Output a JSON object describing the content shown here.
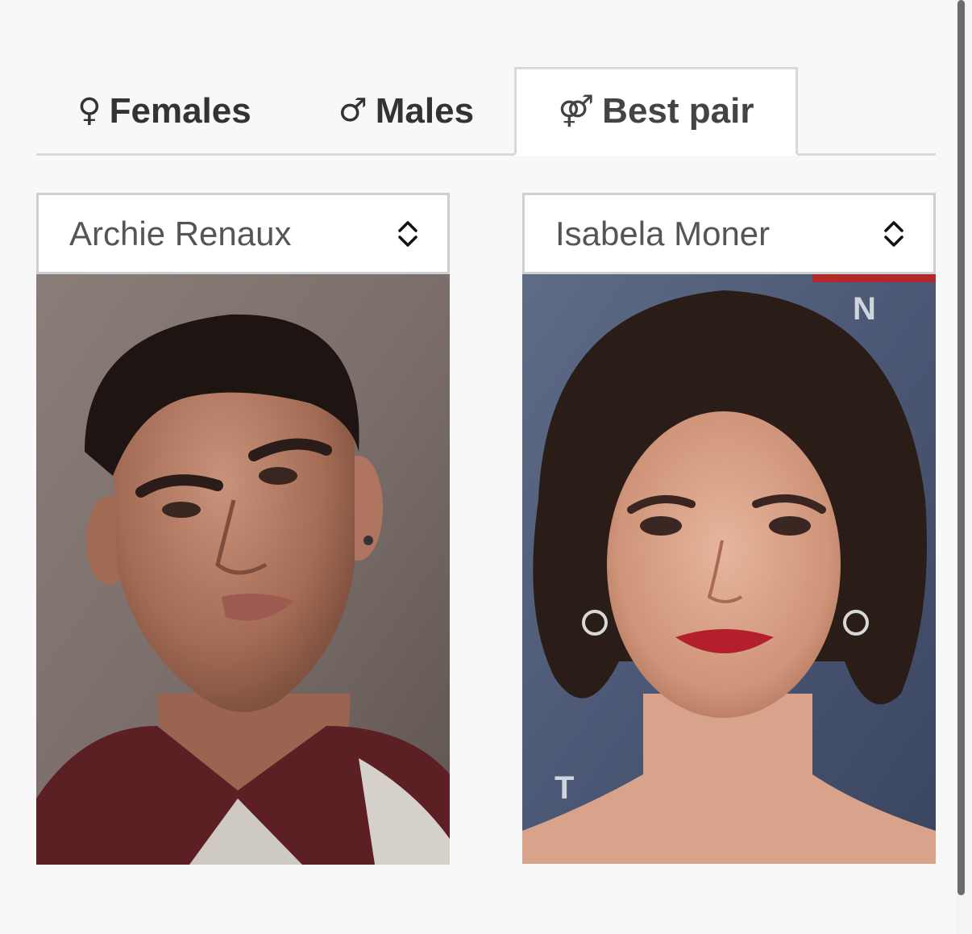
{
  "tabs": [
    {
      "symbol": "♀",
      "label": "Females",
      "active": false
    },
    {
      "symbol": "♂",
      "label": "Males",
      "active": false
    },
    {
      "symbol": "⚤",
      "label": "Best pair",
      "active": true
    }
  ],
  "left_select": {
    "value": "Archie Renaux"
  },
  "right_select": {
    "value": "Isabela Moner"
  },
  "left_photo": {
    "subject": "Archie Renaux",
    "backdrop_letters": ""
  },
  "right_photo": {
    "subject": "Isabela Moner",
    "backdrop_letters": "N",
    "backdrop_letters_2": "T"
  },
  "colors": {
    "background": "#f8f8f8",
    "tab_text": "#333333",
    "border": "#d9d9d9",
    "select_text": "#555555"
  }
}
